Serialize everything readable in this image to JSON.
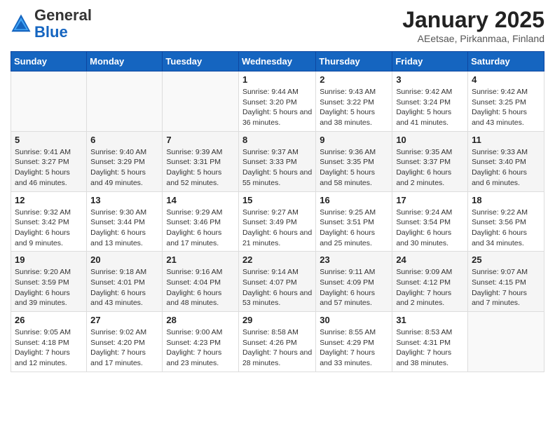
{
  "header": {
    "logo_general": "General",
    "logo_blue": "Blue",
    "month_title": "January 2025",
    "location": "AEetsae, Pirkanmaa, Finland"
  },
  "weekdays": [
    "Sunday",
    "Monday",
    "Tuesday",
    "Wednesday",
    "Thursday",
    "Friday",
    "Saturday"
  ],
  "weeks": [
    [
      null,
      null,
      null,
      {
        "day": 1,
        "sunrise": "9:44 AM",
        "sunset": "3:20 PM",
        "daylight": "5 hours and 36 minutes."
      },
      {
        "day": 2,
        "sunrise": "9:43 AM",
        "sunset": "3:22 PM",
        "daylight": "5 hours and 38 minutes."
      },
      {
        "day": 3,
        "sunrise": "9:42 AM",
        "sunset": "3:24 PM",
        "daylight": "5 hours and 41 minutes."
      },
      {
        "day": 4,
        "sunrise": "9:42 AM",
        "sunset": "3:25 PM",
        "daylight": "5 hours and 43 minutes."
      }
    ],
    [
      {
        "day": 5,
        "sunrise": "9:41 AM",
        "sunset": "3:27 PM",
        "daylight": "5 hours and 46 minutes."
      },
      {
        "day": 6,
        "sunrise": "9:40 AM",
        "sunset": "3:29 PM",
        "daylight": "5 hours and 49 minutes."
      },
      {
        "day": 7,
        "sunrise": "9:39 AM",
        "sunset": "3:31 PM",
        "daylight": "5 hours and 52 minutes."
      },
      {
        "day": 8,
        "sunrise": "9:37 AM",
        "sunset": "3:33 PM",
        "daylight": "5 hours and 55 minutes."
      },
      {
        "day": 9,
        "sunrise": "9:36 AM",
        "sunset": "3:35 PM",
        "daylight": "5 hours and 58 minutes."
      },
      {
        "day": 10,
        "sunrise": "9:35 AM",
        "sunset": "3:37 PM",
        "daylight": "6 hours and 2 minutes."
      },
      {
        "day": 11,
        "sunrise": "9:33 AM",
        "sunset": "3:40 PM",
        "daylight": "6 hours and 6 minutes."
      }
    ],
    [
      {
        "day": 12,
        "sunrise": "9:32 AM",
        "sunset": "3:42 PM",
        "daylight": "6 hours and 9 minutes."
      },
      {
        "day": 13,
        "sunrise": "9:30 AM",
        "sunset": "3:44 PM",
        "daylight": "6 hours and 13 minutes."
      },
      {
        "day": 14,
        "sunrise": "9:29 AM",
        "sunset": "3:46 PM",
        "daylight": "6 hours and 17 minutes."
      },
      {
        "day": 15,
        "sunrise": "9:27 AM",
        "sunset": "3:49 PM",
        "daylight": "6 hours and 21 minutes."
      },
      {
        "day": 16,
        "sunrise": "9:25 AM",
        "sunset": "3:51 PM",
        "daylight": "6 hours and 25 minutes."
      },
      {
        "day": 17,
        "sunrise": "9:24 AM",
        "sunset": "3:54 PM",
        "daylight": "6 hours and 30 minutes."
      },
      {
        "day": 18,
        "sunrise": "9:22 AM",
        "sunset": "3:56 PM",
        "daylight": "6 hours and 34 minutes."
      }
    ],
    [
      {
        "day": 19,
        "sunrise": "9:20 AM",
        "sunset": "3:59 PM",
        "daylight": "6 hours and 39 minutes."
      },
      {
        "day": 20,
        "sunrise": "9:18 AM",
        "sunset": "4:01 PM",
        "daylight": "6 hours and 43 minutes."
      },
      {
        "day": 21,
        "sunrise": "9:16 AM",
        "sunset": "4:04 PM",
        "daylight": "6 hours and 48 minutes."
      },
      {
        "day": 22,
        "sunrise": "9:14 AM",
        "sunset": "4:07 PM",
        "daylight": "6 hours and 53 minutes."
      },
      {
        "day": 23,
        "sunrise": "9:11 AM",
        "sunset": "4:09 PM",
        "daylight": "6 hours and 57 minutes."
      },
      {
        "day": 24,
        "sunrise": "9:09 AM",
        "sunset": "4:12 PM",
        "daylight": "7 hours and 2 minutes."
      },
      {
        "day": 25,
        "sunrise": "9:07 AM",
        "sunset": "4:15 PM",
        "daylight": "7 hours and 7 minutes."
      }
    ],
    [
      {
        "day": 26,
        "sunrise": "9:05 AM",
        "sunset": "4:18 PM",
        "daylight": "7 hours and 12 minutes."
      },
      {
        "day": 27,
        "sunrise": "9:02 AM",
        "sunset": "4:20 PM",
        "daylight": "7 hours and 17 minutes."
      },
      {
        "day": 28,
        "sunrise": "9:00 AM",
        "sunset": "4:23 PM",
        "daylight": "7 hours and 23 minutes."
      },
      {
        "day": 29,
        "sunrise": "8:58 AM",
        "sunset": "4:26 PM",
        "daylight": "7 hours and 28 minutes."
      },
      {
        "day": 30,
        "sunrise": "8:55 AM",
        "sunset": "4:29 PM",
        "daylight": "7 hours and 33 minutes."
      },
      {
        "day": 31,
        "sunrise": "8:53 AM",
        "sunset": "4:31 PM",
        "daylight": "7 hours and 38 minutes."
      },
      null
    ]
  ]
}
